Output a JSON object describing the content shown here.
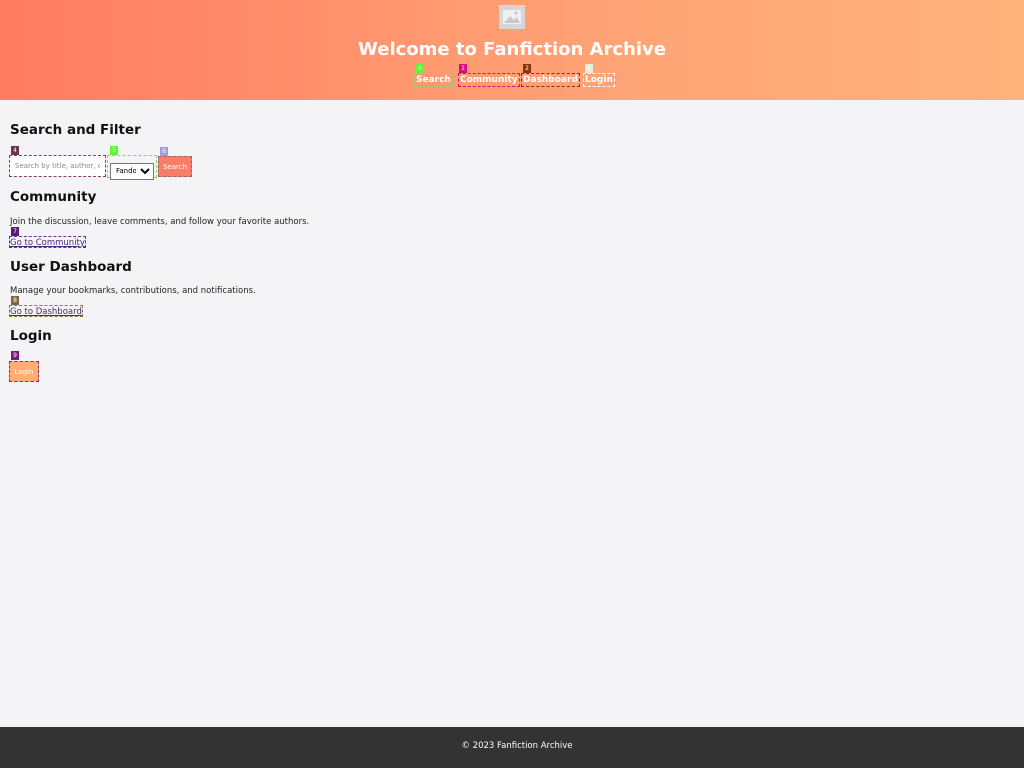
{
  "header": {
    "title": "Welcome to Fanfiction Archive",
    "logo_icon": "image-placeholder-icon",
    "nav": [
      {
        "label": "Search",
        "badge": "0",
        "badge_color": "#5ff53a"
      },
      {
        "label": "Community",
        "badge": "1",
        "badge_color": "#d4127a"
      },
      {
        "label": "Dashboard",
        "badge": "2",
        "badge_color": "#8a3310"
      },
      {
        "label": "Login",
        "badge": "3",
        "badge_color": "#e3eddc"
      }
    ]
  },
  "search_section": {
    "title": "Search and Filter",
    "input_placeholder": "Search by title, author, or tags...",
    "input_badge": "4",
    "input_badge_color": "#6e3549",
    "select_value": "Fandom",
    "select_badge": "5",
    "select_badge_color": "#5ff53a",
    "button_label": "Search",
    "button_badge": "6",
    "button_badge_color": "#a59ad6"
  },
  "community_section": {
    "title": "Community",
    "text": "Join the discussion, leave comments, and follow your favorite authors.",
    "link_label": "Go to Community",
    "link_badge": "7",
    "link_badge_color": "#5b1a7a"
  },
  "dashboard_section": {
    "title": "User Dashboard",
    "text": "Manage your bookmarks, contributions, and notifications.",
    "link_label": "Go to Dashboard",
    "link_badge": "8",
    "link_badge_color": "#7a6a40"
  },
  "login_section": {
    "title": "Login",
    "button_label": "Login",
    "button_badge": "9",
    "button_badge_color": "#7a1a7a"
  },
  "footer": {
    "text": "© 2023 Fanfiction Archive"
  }
}
